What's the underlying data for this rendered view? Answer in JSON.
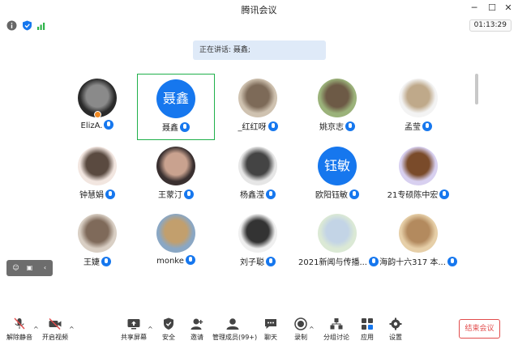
{
  "window": {
    "title": "腾讯会议"
  },
  "status": {
    "timer": "01:13:29"
  },
  "speaking": {
    "text": "正在讲话: 聂鑫;"
  },
  "participants": [
    {
      "name": "ElizA.",
      "initials": ""
    },
    {
      "name": "聂鑫",
      "initials": "聂鑫"
    },
    {
      "name": "_红红呀",
      "initials": ""
    },
    {
      "name": "姚京志",
      "initials": ""
    },
    {
      "name": "孟莹",
      "initials": ""
    },
    {
      "name": "钟慧娟",
      "initials": ""
    },
    {
      "name": "王蒙汀",
      "initials": ""
    },
    {
      "name": "杨鑫滢",
      "initials": ""
    },
    {
      "name": "欧阳钰敏",
      "initials": "钰敏"
    },
    {
      "name": "21专硕陈中宏",
      "initials": ""
    },
    {
      "name": "王婕",
      "initials": ""
    },
    {
      "name": "monke",
      "initials": ""
    },
    {
      "name": "刘子聪",
      "initials": ""
    },
    {
      "name": "2021新闻与传播...",
      "initials": ""
    },
    {
      "name": "海韵十六317 本...",
      "initials": ""
    }
  ],
  "toolbar": {
    "unmute": "解除静音",
    "video": "开启视频",
    "share": "共享屏幕",
    "security": "安全",
    "invite": "邀请",
    "members": "管理成员(99+)",
    "chat": "聊天",
    "record": "录制",
    "breakout": "分组讨论",
    "apps": "应用",
    "settings": "设置",
    "end": "结束会议"
  },
  "colors": {
    "accent": "#1677ee",
    "active_border": "#20b04b",
    "end": "#e24c4c"
  }
}
